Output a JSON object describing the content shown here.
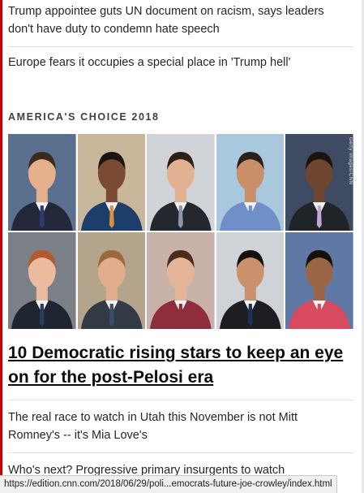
{
  "stories": {
    "top1": "Trump appointee guts UN document on racism, says leaders don't have duty to condemn hate speech",
    "top2": "Europe fears it occupies a special place in 'Trump hell'",
    "bottom1": "The real race to watch in Utah this November is not Mitt Romney's -- it's Mia Love's",
    "bottom2": "Who's next? Progressive primary insurgents to watch"
  },
  "section": {
    "title": "AMERICA'S CHOICE 2018"
  },
  "image": {
    "credit": "Getty Images/CNN"
  },
  "feature": {
    "headline": "10 Democratic rising stars to keep an eye on for the post-Pelosi era"
  },
  "status_bar": {
    "url": "https://edition.cnn.com/2018/06/29/poli...emocrats-future-joe-crowley/index.html"
  },
  "colors": {
    "accent": "#cc0000"
  },
  "photos": [
    {
      "bg": "#5b6f8f",
      "skin": "#e6b08c",
      "hair": "#3a2a1f",
      "suit": "#22283a",
      "tie": "#2b3c6a"
    },
    {
      "bg": "#c8b79a",
      "skin": "#7a4a32",
      "hair": "#1c1410",
      "suit": "#1d3d6b",
      "tie": "#d7913a"
    },
    {
      "bg": "#d0d4d8",
      "skin": "#e2b192",
      "hair": "#2b1f16",
      "suit": "#24272d",
      "tie": "#8b96a8"
    },
    {
      "bg": "#a9c8de",
      "skin": "#c88f68",
      "hair": "#2a211b",
      "suit": "#6f8fc9",
      "tie": "#6f8fc9"
    },
    {
      "bg": "#3e4b63",
      "skin": "#6e4632",
      "hair": "#1a1410",
      "suit": "#202328",
      "tie": "#c1a8d6"
    },
    {
      "bg": "#7b7f86",
      "skin": "#ebbba0",
      "hair": "#b4592c",
      "suit": "#1f2530",
      "tie": "#2c3c5f"
    },
    {
      "bg": "#b3a48b",
      "skin": "#e1ad8c",
      "hair": "#9a6a3c",
      "suit": "#323a46",
      "tie": "#3b4b6b"
    },
    {
      "bg": "#c9b2aa",
      "skin": "#e4b497",
      "hair": "#4a2b1c",
      "suit": "#8e2d3d",
      "tie": "#8e2d3d"
    },
    {
      "bg": "#cfd3d8",
      "skin": "#c9916c",
      "hair": "#141010",
      "suit": "#1c1e24",
      "tie": "#1f2f55"
    },
    {
      "bg": "#5f79a4",
      "skin": "#9a6446",
      "hair": "#15100d",
      "suit": "#d84a5e",
      "tie": "#d84a5e"
    }
  ]
}
